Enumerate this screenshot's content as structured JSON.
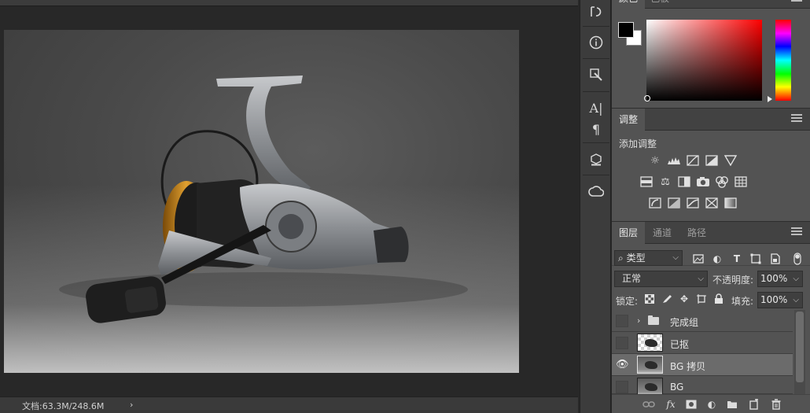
{
  "status_bar": {
    "doc_size": "文档:63.3M/248.6M",
    "arrow": "›"
  },
  "color_panel": {
    "tabs": [
      {
        "label": "颜色"
      },
      {
        "label": "色板"
      }
    ],
    "foreground": "#000000",
    "background": "#ffffff"
  },
  "adjustments_panel": {
    "tab": "调整",
    "title": "添加调整"
  },
  "layers_panel": {
    "tabs": [
      {
        "label": "图层"
      },
      {
        "label": "通道"
      },
      {
        "label": "路径"
      }
    ],
    "filter_kind": "类型",
    "blend_mode": "正常",
    "opacity_label": "不透明度:",
    "opacity_value": "100%",
    "lock_label": "锁定:",
    "fill_label": "填充:",
    "fill_value": "100%",
    "layers": [
      {
        "name": "完成组",
        "type": "group",
        "visible": false,
        "selected": false
      },
      {
        "name": "已抠",
        "type": "cutout",
        "visible": false,
        "selected": false
      },
      {
        "name": "BG 拷贝",
        "type": "photo",
        "visible": true,
        "selected": true
      },
      {
        "name": "BG",
        "type": "photo",
        "visible": false,
        "selected": false
      }
    ],
    "footer_fx": "fx"
  },
  "colors": {
    "panel_bg": "#535353",
    "selected_row": "#6b6b6b"
  }
}
